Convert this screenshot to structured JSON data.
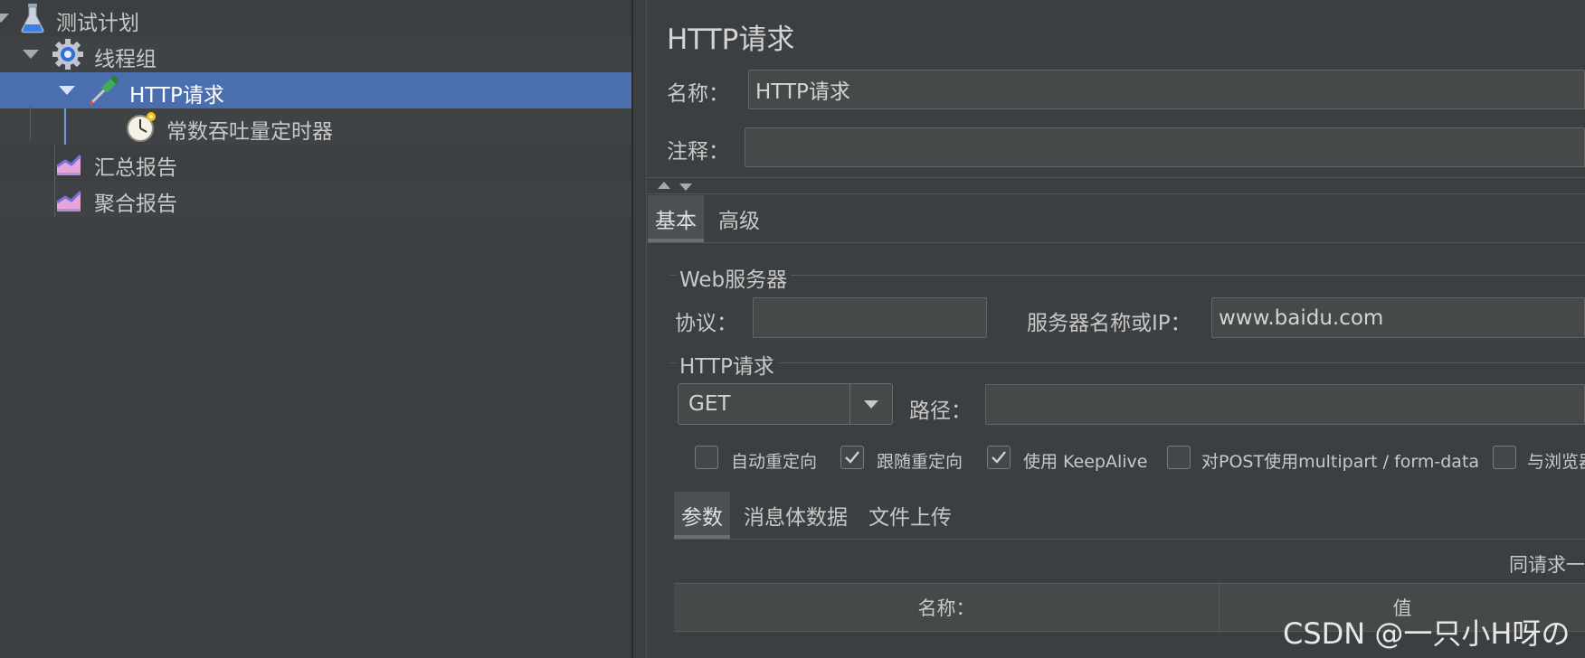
{
  "tree": {
    "items": [
      {
        "label": "测试计划"
      },
      {
        "label": "线程组"
      },
      {
        "label": "HTTP请求"
      },
      {
        "label": "常数吞吐量定时器"
      },
      {
        "label": "汇总报告"
      },
      {
        "label": "聚合报告"
      }
    ]
  },
  "panel": {
    "title": "HTTP请求",
    "name_label": "名称：",
    "name_value": "HTTP请求",
    "comment_label": "注释：",
    "comment_value": "",
    "tabs": [
      "基本",
      "高级"
    ],
    "web_server": {
      "group_label": "Web服务器",
      "protocol_label": "协议：",
      "protocol_value": "",
      "server_label": "服务器名称或IP：",
      "server_value": "www.baidu.com"
    },
    "http_request": {
      "group_label": "HTTP请求",
      "method": "GET",
      "path_label": "路径：",
      "path_value": ""
    },
    "checkboxes": [
      {
        "label": "自动重定向",
        "checked": false
      },
      {
        "label": "跟随重定向",
        "checked": true
      },
      {
        "label": "使用 KeepAlive",
        "checked": true
      },
      {
        "label": "对POST使用multipart / form-data",
        "checked": false
      },
      {
        "label": "与浏览器",
        "checked": false
      }
    ],
    "sub_tabs": [
      "参数",
      "消息体数据",
      "文件上传"
    ],
    "send_with_request": "同请求一",
    "table_headers": [
      "名称：",
      "值"
    ]
  },
  "watermark": "CSDN @一只小H呀の",
  "colors": {
    "selection": "#4b6eaf",
    "background": "#3c3f41"
  }
}
